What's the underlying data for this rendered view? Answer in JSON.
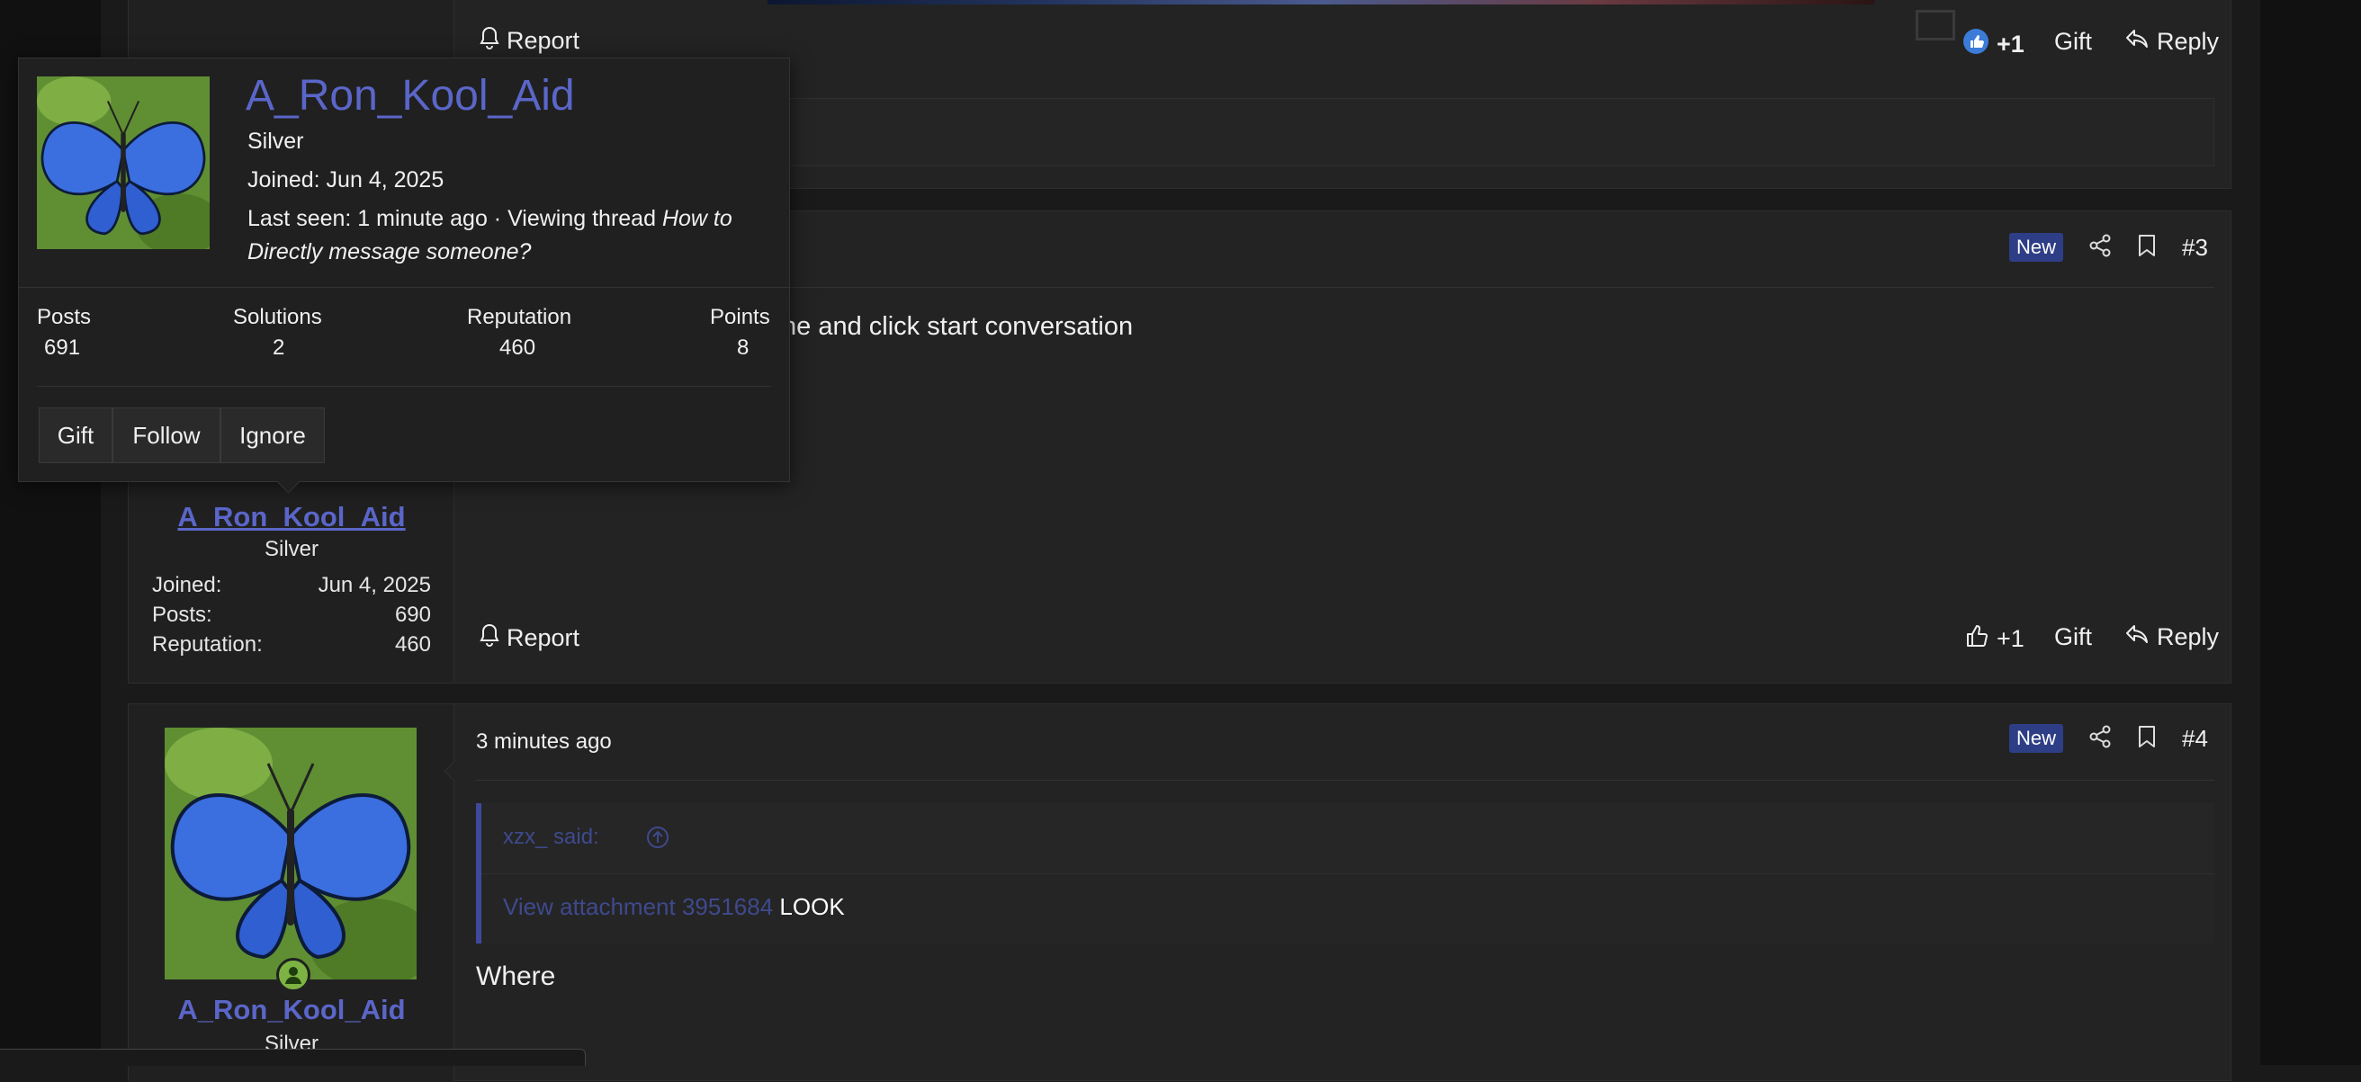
{
  "hover_card": {
    "username": "A_Ron_Kool_Aid",
    "rank": "Silver",
    "joined": "Joined: Jun 4, 2025",
    "last_seen_prefix": "Last seen: 1 minute ago · Viewing thread ",
    "thread_title": "How to Directly message someone?",
    "stats": [
      {
        "label": "Posts",
        "value": "691"
      },
      {
        "label": "Solutions",
        "value": "2"
      },
      {
        "label": "Reputation",
        "value": "460"
      },
      {
        "label": "Points",
        "value": "8"
      }
    ],
    "buttons": {
      "gift": "Gift",
      "follow": "Follow",
      "ignore": "Ignore"
    }
  },
  "post_top": {
    "report": "Report",
    "like_count": "+1",
    "gift": "Gift",
    "reply": "Reply"
  },
  "post3": {
    "badge": "New",
    "number": "#3",
    "body_fragment": "ne and click start conversation",
    "author": "A_Ron_Kool_Aid",
    "rank": "Silver",
    "meta": [
      {
        "label": "Joined:",
        "value": "Jun 4, 2025"
      },
      {
        "label": "Posts:",
        "value": "690"
      },
      {
        "label": "Reputation:",
        "value": "460"
      }
    ],
    "report": "Report",
    "like_count": "+1",
    "gift": "Gift",
    "reply": "Reply"
  },
  "post4": {
    "time": "3 minutes ago",
    "badge": "New",
    "number": "#4",
    "quote_author": "xzx_ said:",
    "quote_link": "View attachment 3951684",
    "quote_text": "LOOK",
    "body": "Where",
    "author": "A_Ron_Kool_Aid",
    "rank": "Silver"
  },
  "colors": {
    "accent": "#5b66c9",
    "badge": "#2e3e86",
    "background": "#1a1a1a",
    "online": "#7cb342"
  }
}
